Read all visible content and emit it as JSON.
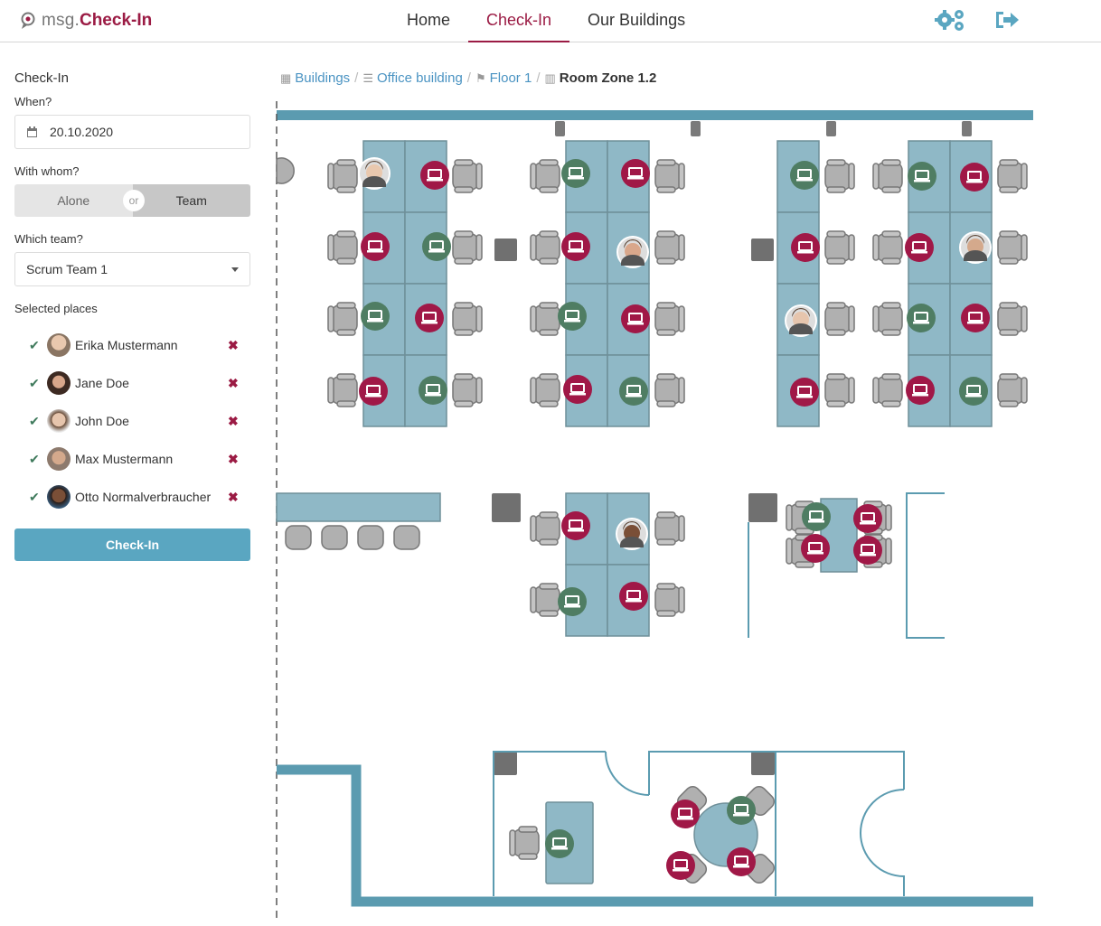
{
  "app": {
    "logo_prefix": "msg.",
    "logo_name": "Check-In"
  },
  "nav": {
    "home": "Home",
    "checkin": "Check-In",
    "buildings": "Our Buildings"
  },
  "header_icons": {
    "settings": "gears-icon",
    "logout": "sign-out-icon"
  },
  "sidebar": {
    "title": "Check-In",
    "when_label": "When?",
    "date_value": "20.10.2020",
    "with_whom_label": "With whom?",
    "toggle_alone": "Alone",
    "toggle_or": "or",
    "toggle_team": "Team",
    "toggle_selected": "Team",
    "which_team_label": "Which team?",
    "team_value": "Scrum Team 1",
    "selected_places_label": "Selected places",
    "people": [
      {
        "name": "Erika Mustermann"
      },
      {
        "name": "Jane Doe"
      },
      {
        "name": "John Doe"
      },
      {
        "name": "Max Mustermann"
      },
      {
        "name": "Otto Normalverbraucher"
      }
    ],
    "checkin_button": "Check-In"
  },
  "breadcrumb": {
    "buildings": "Buildings",
    "office": "Office building",
    "floor": "Floor 1",
    "zone": "Room Zone 1.2"
  },
  "colors": {
    "brand": "#9b1b44",
    "accent": "#5aa6c1",
    "desk": "#8fb8c6",
    "available": "#4f7d63",
    "occupied": "#a01847",
    "wall": "#5b9bb0"
  }
}
